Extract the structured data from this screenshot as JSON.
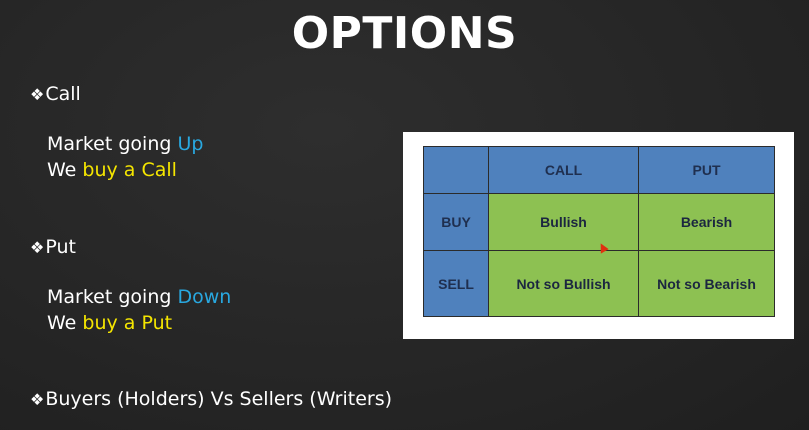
{
  "slide": {
    "title": "OPTIONS"
  },
  "bullets": {
    "marker": "❖",
    "call": {
      "label": "Call",
      "line1_prefix": "Market going ",
      "line1_accent": "Up",
      "line2_prefix": "We ",
      "line2_accent": "buy a Call"
    },
    "put": {
      "label": "Put",
      "line1_prefix": "Market going ",
      "line1_accent": "Down",
      "line2_prefix": "We ",
      "line2_accent": "buy a Put"
    },
    "third": {
      "label": "Buyers (Holders) Vs Sellers (Writers)"
    }
  },
  "table": {
    "headers": [
      "",
      "CALL",
      "PUT"
    ],
    "rows": [
      {
        "label": "BUY",
        "cells": [
          "Bullish",
          "Bearish"
        ]
      },
      {
        "label": "SELL",
        "cells": [
          "Not so Bullish",
          "Not so Bearish"
        ]
      }
    ]
  },
  "colors": {
    "accent_blue": "#29a8e0",
    "accent_yellow": "#f5e600",
    "header_blue": "#4f81bd",
    "cell_green": "#8dc152",
    "cursor_red": "#e03010"
  },
  "icons": {
    "bullet": "diamond-bullet-icon",
    "cursor": "mouse-pointer-icon"
  }
}
